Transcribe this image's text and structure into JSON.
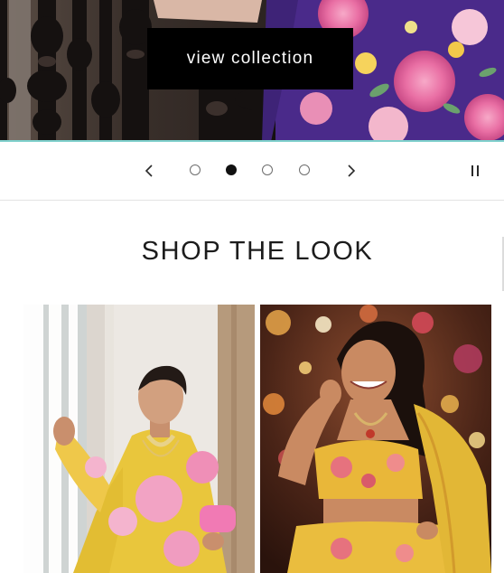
{
  "hero": {
    "cta_label": "view collection",
    "rule_color": "#7fd0cc"
  },
  "slider": {
    "slide_count": 4,
    "active_slide": 2,
    "prev_icon": "chevron-left-icon",
    "next_icon": "chevron-right-icon",
    "pause_icon": "pause-icon"
  },
  "shop_the_look": {
    "title": "SHOP THE LOOK",
    "cards": [
      {
        "image": "woman-in-yellow-floral-anarkali-by-window"
      },
      {
        "image": "smiling-woman-in-yellow-floral-lehenga-with-dupatta"
      }
    ]
  }
}
